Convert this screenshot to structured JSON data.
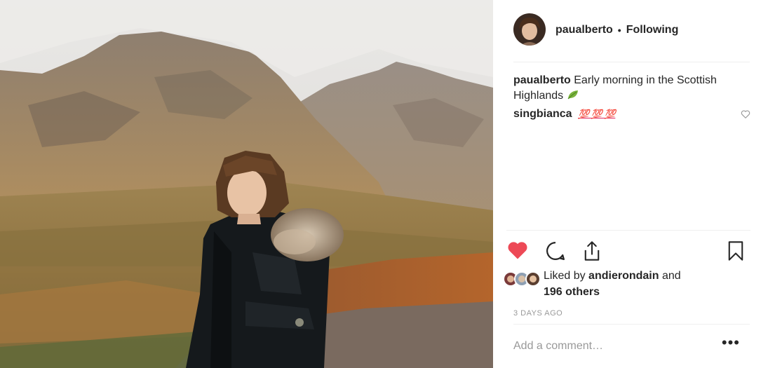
{
  "post": {
    "photo_alt": "Woman in black parka in the Scottish Highlands",
    "author": "paualberto",
    "follow_state": "Following",
    "caption_user": "paualberto",
    "caption_text": "Early morning in the Scottish Highlands",
    "caption_emoji": "leaf-icon",
    "comments": [
      {
        "user": "singbianca",
        "text": "💯 💯 💯"
      }
    ],
    "likes_prefix": "Liked by",
    "likes_user": "andierondain",
    "likes_and": "and",
    "likes_others": "196 others",
    "timestamp": "3 DAYS AGO",
    "comment_placeholder": "Add a comment…",
    "more_label": "•••",
    "liked": true,
    "colors": {
      "heart": "#ed4956",
      "text": "#262626",
      "muted": "#999999",
      "border": "#efefef"
    }
  }
}
